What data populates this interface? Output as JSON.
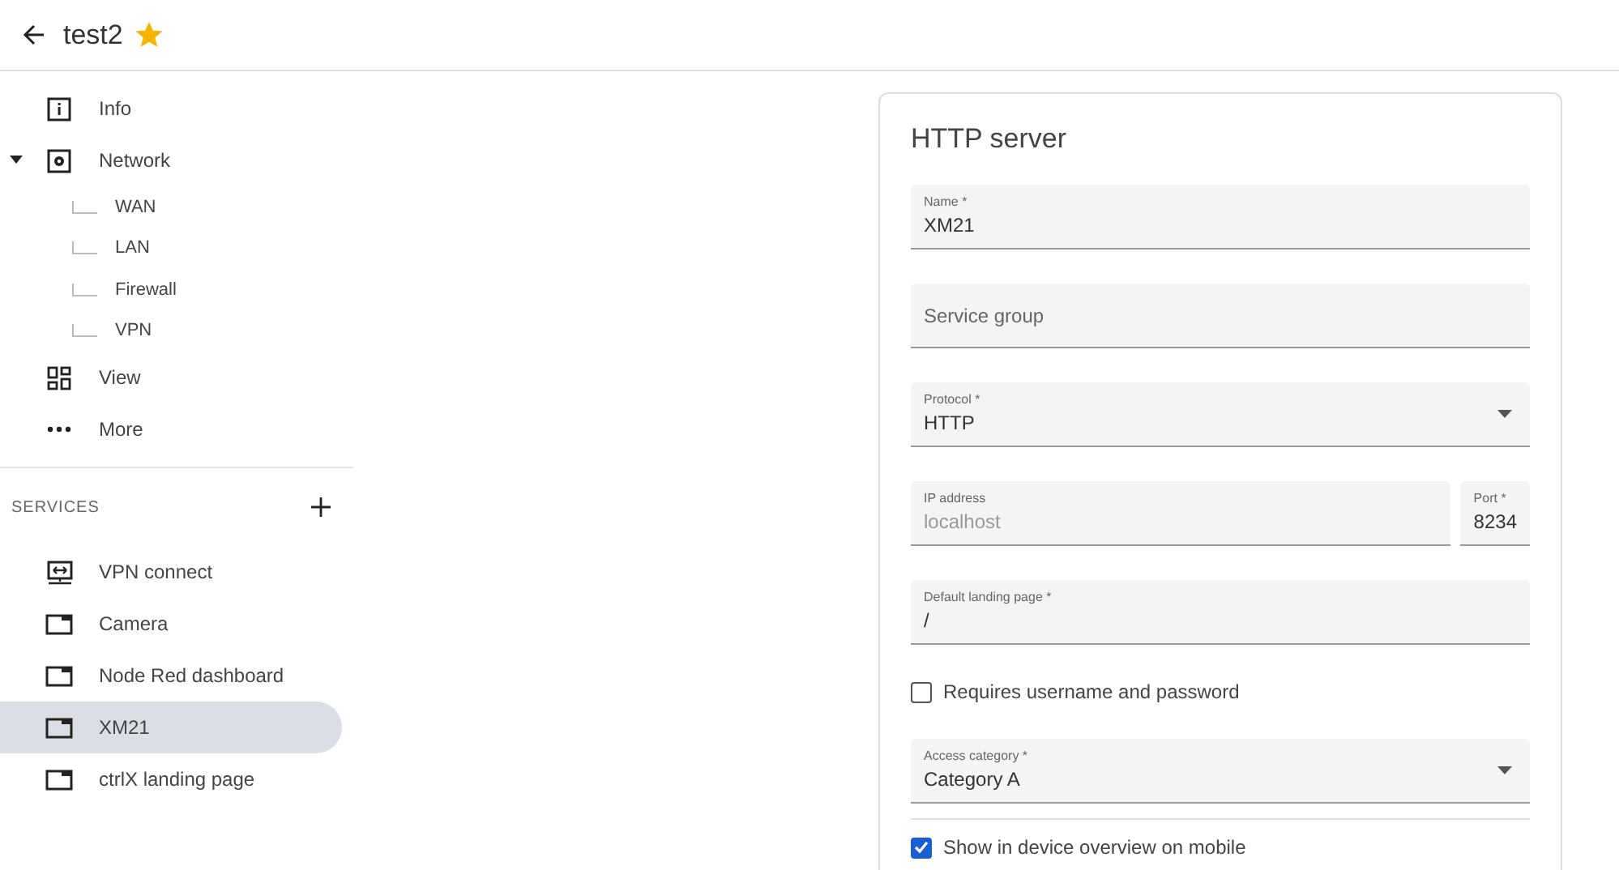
{
  "header": {
    "title": "test2",
    "favorite": true
  },
  "nav": [
    {
      "label": "Info"
    },
    {
      "label": "Network",
      "expanded": true,
      "children": [
        {
          "label": "WAN"
        },
        {
          "label": "LAN"
        },
        {
          "label": "Firewall"
        },
        {
          "label": "VPN"
        }
      ]
    },
    {
      "label": "View"
    },
    {
      "label": "More"
    }
  ],
  "services": {
    "heading": "SERVICES",
    "items": [
      {
        "label": "VPN connect",
        "selected": false
      },
      {
        "label": "Camera",
        "selected": false
      },
      {
        "label": "Node Red dashboard",
        "selected": false
      },
      {
        "label": "XM21",
        "selected": true
      },
      {
        "label": "ctrlX landing page",
        "selected": false
      }
    ]
  },
  "form": {
    "title": "HTTP server",
    "fields": [
      {
        "kind": "text",
        "label": "Name *",
        "value": "XM21"
      },
      {
        "kind": "text",
        "placeholder": "Service group"
      },
      {
        "kind": "select",
        "label": "Protocol *",
        "value": "HTTP"
      },
      {
        "kind": "pair",
        "fields": [
          {
            "kind": "text",
            "label": "IP address",
            "value": "localhost",
            "disabled": true
          },
          {
            "kind": "text",
            "label": "Port *",
            "value": "8234",
            "disabled": false
          }
        ]
      },
      {
        "kind": "text",
        "label": "Default landing page *",
        "value": "/"
      },
      {
        "kind": "checkbox",
        "label": "Requires username and password",
        "checked": false
      },
      {
        "kind": "select",
        "label": "Access category *",
        "value": "Category A"
      },
      {
        "kind": "checkbox",
        "label": "Show in device overview on mobile",
        "checked": true
      }
    ]
  }
}
